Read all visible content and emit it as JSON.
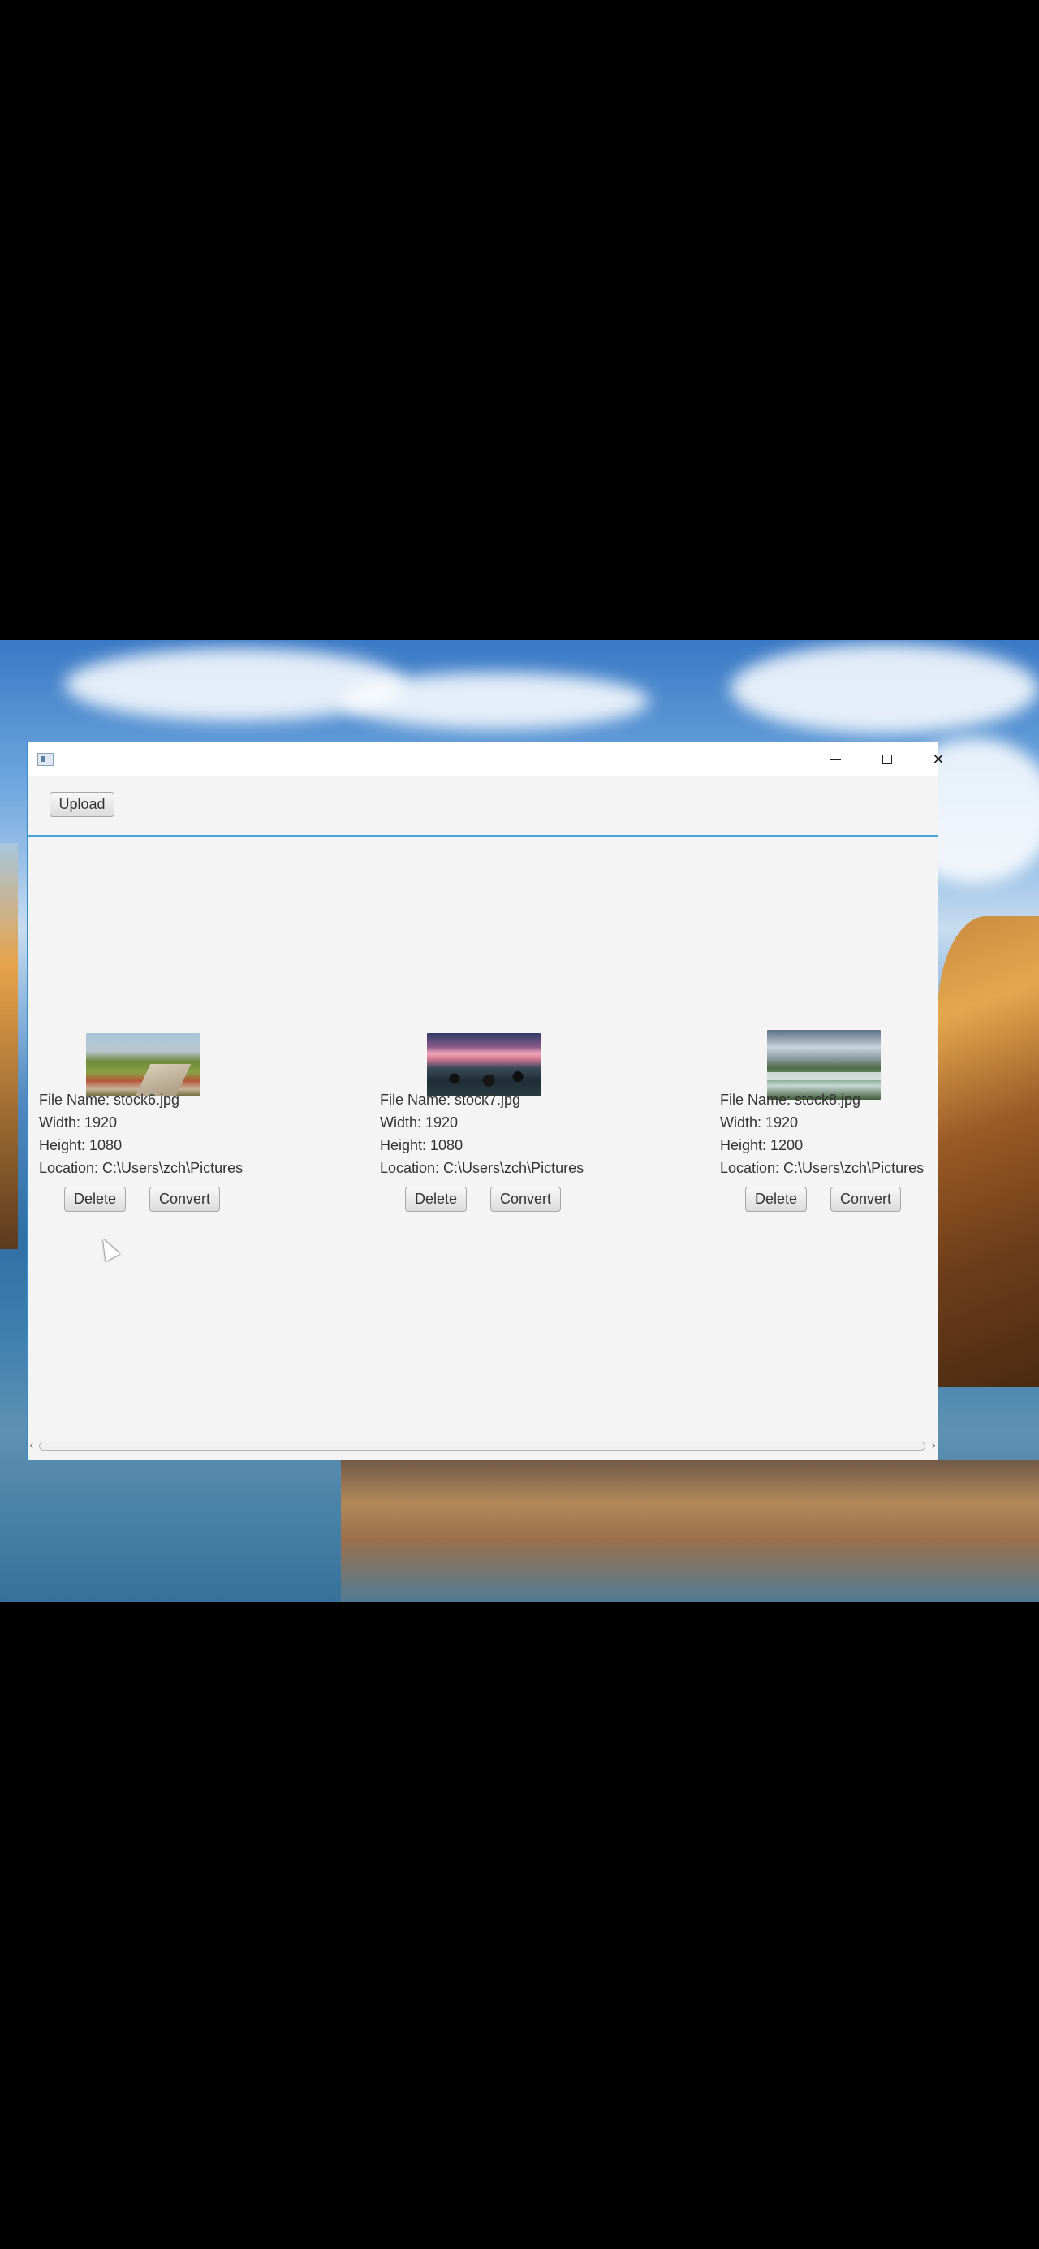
{
  "window": {
    "app_icon": "app-window-icon",
    "controls": {
      "minimize_icon": "minimize-icon",
      "maximize_icon": "maximize-icon",
      "close_glyph": "✕"
    }
  },
  "toolbar": {
    "upload_label": "Upload"
  },
  "images": [
    {
      "file_name": "File Name: stock6.jpg",
      "width": "Width: 1920",
      "height": "Height: 1080",
      "location": "Location: C:\\Users\\zch\\Pictures",
      "delete_label": "Delete",
      "convert_label": "Convert"
    },
    {
      "file_name": "File Name: stock7.jpg",
      "width": "Width: 1920",
      "height": "Height: 1080",
      "location": "Location: C:\\Users\\zch\\Pictures",
      "delete_label": "Delete",
      "convert_label": "Convert"
    },
    {
      "file_name": "File Name: stock8.jpg",
      "width": "Width: 1920",
      "height": "Height: 1200",
      "location": "Location: C:\\Users\\zch\\Pictures",
      "delete_label": "Delete",
      "convert_label": "Convert"
    }
  ],
  "scrollbar": {
    "left_arrow": "‹",
    "right_arrow": "›"
  },
  "colors": {
    "window_border": "#2f8fd0",
    "content_bg": "#f4f4f4"
  }
}
